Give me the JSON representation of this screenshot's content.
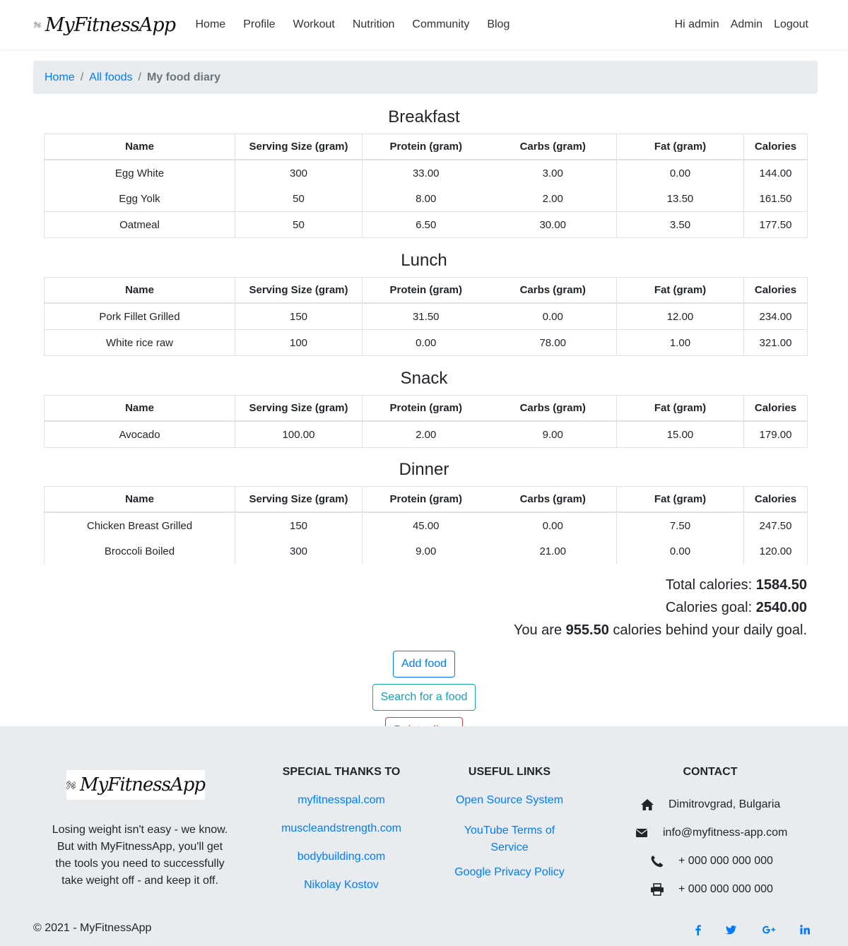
{
  "nav": {
    "brand": "MyFitnessApp",
    "links": [
      "Home",
      "Profile",
      "Workout",
      "Nutrition",
      "Community",
      "Blog"
    ],
    "greeting": "Hi admin",
    "admin": "Admin",
    "logout": "Logout"
  },
  "breadcrumb": {
    "home": "Home",
    "all_foods": "All foods",
    "current": "My food diary"
  },
  "columns": [
    "Name",
    "Serving Size (gram)",
    "Protein (gram)",
    "Carbs (gram)",
    "Fat (gram)",
    "Calories"
  ],
  "meals": {
    "breakfast": {
      "title": "Breakfast",
      "rows": [
        [
          "Egg White",
          "300",
          "33.00",
          "3.00",
          "0.00",
          "144.00"
        ],
        [
          "Egg Yolk",
          "50",
          "8.00",
          "2.00",
          "13.50",
          "161.50"
        ],
        [
          "Oatmeal",
          "50",
          "6.50",
          "30.00",
          "3.50",
          "177.50"
        ]
      ]
    },
    "lunch": {
      "title": "Lunch",
      "rows": [
        [
          "Pork Fillet Grilled",
          "150",
          "31.50",
          "0.00",
          "12.00",
          "234.00"
        ],
        [
          "White rice raw",
          "100",
          "0.00",
          "78.00",
          "1.00",
          "321.00"
        ]
      ]
    },
    "snack": {
      "title": "Snack",
      "rows": [
        [
          "Avocado",
          "100.00",
          "2.00",
          "9.00",
          "15.00",
          "179.00"
        ]
      ]
    },
    "dinner": {
      "title": "Dinner",
      "rows": [
        [
          "Chicken Breast Grilled",
          "150",
          "45.00",
          "0.00",
          "7.50",
          "247.50"
        ],
        [
          "Broccoli Boiled",
          "300",
          "9.00",
          "21.00",
          "0.00",
          "120.00"
        ]
      ]
    }
  },
  "totals": {
    "total_label": "Total calories:",
    "total_value": "1584.50",
    "goal_label": "Calories goal:",
    "goal_value": "2540.00",
    "behind_prefix": "You are",
    "behind_value": "955.50",
    "behind_suffix": "calories behind your daily goal."
  },
  "actions": {
    "add": "Add food",
    "search": "Search for a food",
    "delete": "Delete diary"
  },
  "footer": {
    "brand": "MyFitnessApp",
    "about": "Losing weight isn't easy - we know. But with MyFitnessApp, you'll get the tools you need to successfully take weight off - and keep it off.",
    "thanks_title": "SPECIAL THANKS TO",
    "thanks": [
      "myfitnesspal.com",
      "muscleandstrength.com",
      "bodybuilding.com",
      "Nikolay Kostov"
    ],
    "links_title": "USEFUL LINKS",
    "links": [
      "Open Source System",
      "YouTube Terms of Service",
      "Google Privacy Policy"
    ],
    "contact_title": "CONTACT",
    "address": "Dimitrovgrad, Bulgaria",
    "email": "info@myfitness-app.com",
    "phone": "+ 000 000 000 000",
    "fax": "+ 000 000 000 000",
    "copyright": "© 2021 - MyFitnessApp",
    "social": [
      "facebook-icon",
      "twitter-icon",
      "google-plus-icon",
      "linkedin-icon"
    ]
  },
  "colors": {
    "link": "#007bff",
    "info": "#17a2b8",
    "danger": "#dc3545",
    "muted": "#6c757d",
    "footer_bg": "#e9ecef"
  }
}
